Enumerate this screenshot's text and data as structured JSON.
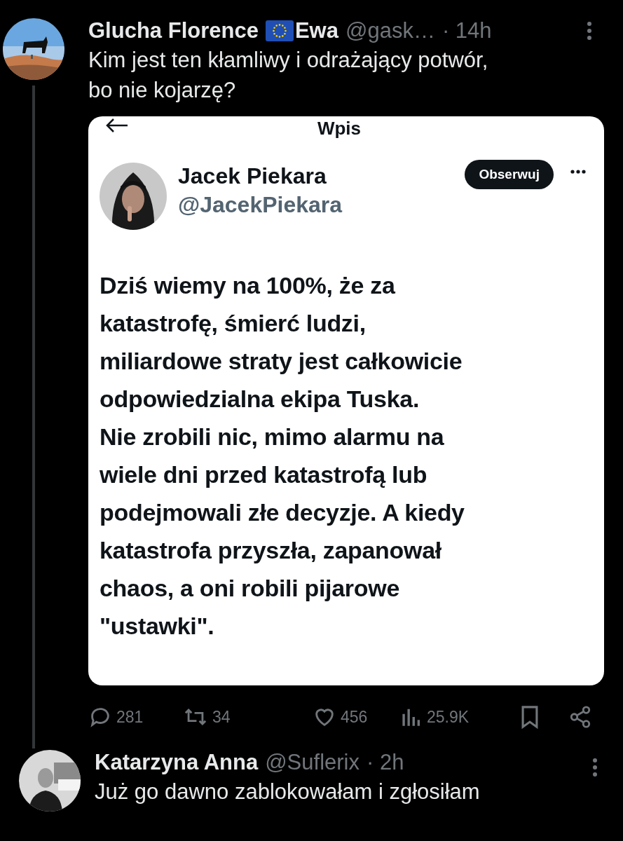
{
  "post": {
    "author_name_parts": [
      "Glucha Florence",
      "Ewa"
    ],
    "handle": "@gask…",
    "time": "· 14h",
    "text": "Kim jest ten kłamliwy i odrażający potwór,\nbo nie kojarzę?",
    "screenshot": {
      "header_title": "Wpis",
      "author_name": "Jacek Piekara",
      "author_handle": "@JacekPiekara",
      "follow_label": "Obserwuj",
      "text": "Dziś wiemy na 100%, że za\nkatastrofę, śmierć ludzi,\nmiliardowe straty jest całkowicie\nodpowiedzialna ekipa Tuska.\nNie zrobili nic, mimo alarmu na\nwiele dni przed katastrofą lub\npodejmowali złe decyzje. A kiedy\nkatastrofa przyszła, zapanował\nchaos, a oni robili pijarowe\n\"ustawki\"."
    },
    "actions": [
      {
        "kind": "reply",
        "count": "281"
      },
      {
        "kind": "repost",
        "count": "34"
      },
      {
        "kind": "like",
        "count": "456"
      },
      {
        "kind": "views",
        "count": "25.9K"
      },
      {
        "kind": "bookmark"
      },
      {
        "kind": "share"
      }
    ]
  },
  "reply": {
    "author_name": "Katarzyna Anna",
    "handle": "@Suflerix",
    "time": "· 2h",
    "text": "Już go dawno zablokowałam i zgłosiłam"
  }
}
